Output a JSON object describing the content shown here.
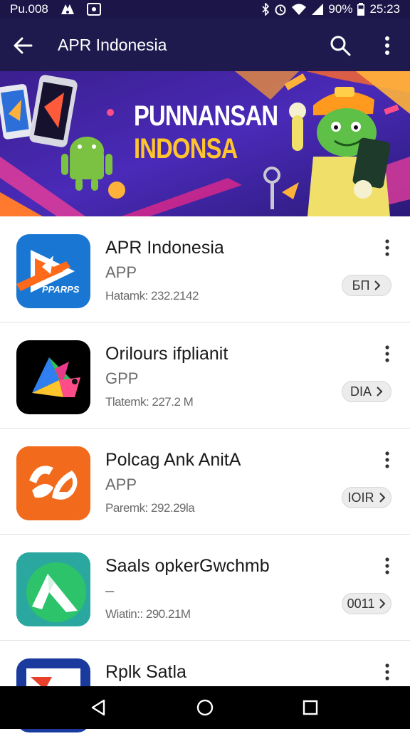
{
  "statusbar": {
    "left_text": "Pu.008",
    "battery": "90%",
    "time": "25:23"
  },
  "appbar": {
    "title": "APR Indonesia"
  },
  "banner": {
    "line1": "PUNNANSAN",
    "line2": "INDONSA"
  },
  "apps": [
    {
      "name": "APR Indonesia",
      "type": "APP",
      "meta": "Hatamk: 232.2142",
      "action": "БП",
      "icon_label": "PPARPS",
      "icon_color": "#1976d2"
    },
    {
      "name": "Orilours ifplianit",
      "type": "GPP",
      "meta": "Tlatemk: 227.2 M",
      "action": "DIA",
      "icon_color": "#000000"
    },
    {
      "name": "Polcag Ank AnitA",
      "type": "APP",
      "meta": "Paremk: 292.29la",
      "action": "IOIR",
      "icon_color": "#f26a1b"
    },
    {
      "name": "Saals opkerGwchmb",
      "type": "–",
      "meta": "Wiatin:: 290.21M",
      "action": "0011",
      "icon_color": "#2eb398"
    },
    {
      "name": "Rplk Satla",
      "icon_color": "#1a3a9e"
    }
  ]
}
